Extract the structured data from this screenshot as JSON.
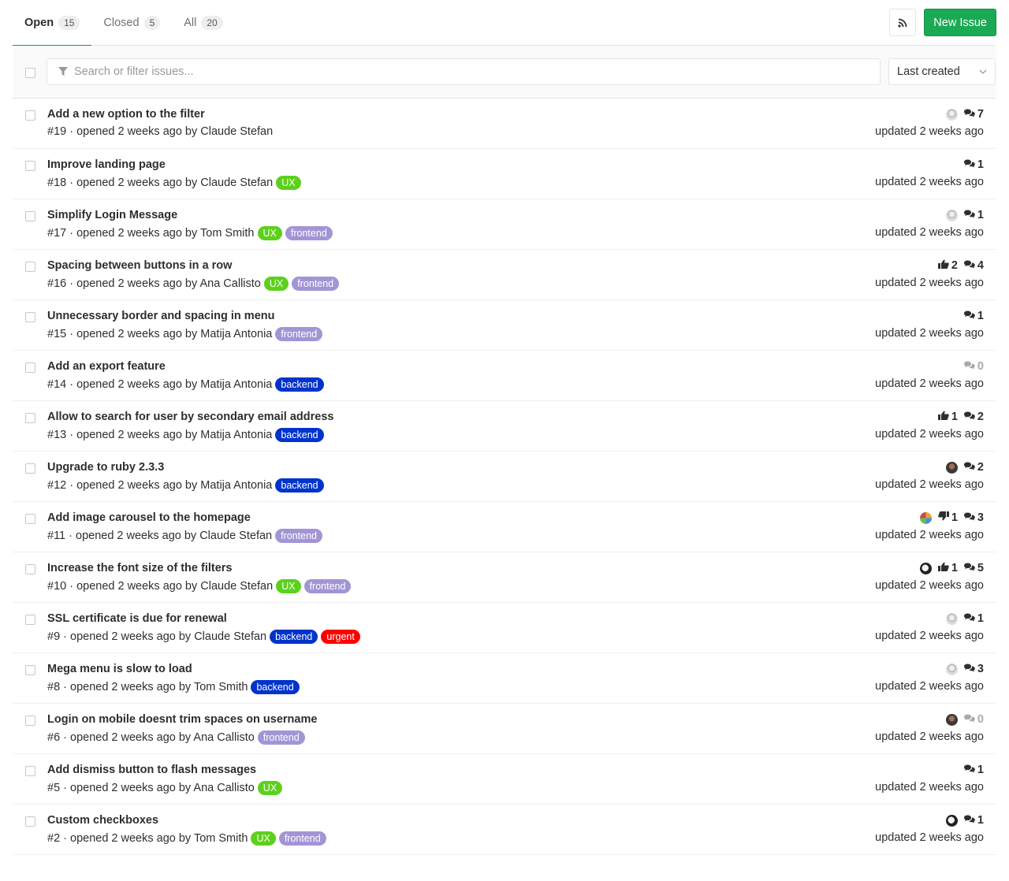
{
  "tabs": [
    {
      "label": "Open",
      "count": "15"
    },
    {
      "label": "Closed",
      "count": "5"
    },
    {
      "label": "All",
      "count": "20"
    }
  ],
  "actions": {
    "new_issue": "New Issue",
    "rss_icon": "rss-icon"
  },
  "filter": {
    "placeholder": "Search or filter issues...",
    "sort": "Last created"
  },
  "colors": {
    "accent": "#1f78d1",
    "new_issue_btn": "#1aaa55",
    "UX": "#5cd11b",
    "frontend": "#a295d6",
    "backend": "#0033cc",
    "urgent": "#ff0000"
  },
  "issues": [
    {
      "title": "Add a new option to the filter",
      "meta": "#19 · opened 2 weeks ago by Claude Stefan",
      "labels": [],
      "avatar": "gray",
      "upvotes": null,
      "downvotes": null,
      "comments": "7",
      "updated": "updated 2 weeks ago"
    },
    {
      "title": "Improve landing page",
      "meta": "#18 · opened 2 weeks ago by Claude Stefan",
      "labels": [
        "UX"
      ],
      "avatar": null,
      "upvotes": null,
      "downvotes": null,
      "comments": "1",
      "updated": "updated 2 weeks ago"
    },
    {
      "title": "Simplify Login Message",
      "meta": "#17 · opened 2 weeks ago by Tom Smith",
      "labels": [
        "UX",
        "frontend"
      ],
      "avatar": "gray",
      "upvotes": null,
      "downvotes": null,
      "comments": "1",
      "updated": "updated 2 weeks ago"
    },
    {
      "title": "Spacing between buttons in a row",
      "meta": "#16 · opened 2 weeks ago by Ana Callisto",
      "labels": [
        "UX",
        "frontend"
      ],
      "avatar": null,
      "upvotes": "2",
      "downvotes": null,
      "comments": "4",
      "updated": "updated 2 weeks ago"
    },
    {
      "title": "Unnecessary border and spacing in menu",
      "meta": "#15 · opened 2 weeks ago by Matija Antonia",
      "labels": [
        "frontend"
      ],
      "avatar": null,
      "upvotes": null,
      "downvotes": null,
      "comments": "1",
      "updated": "updated 2 weeks ago"
    },
    {
      "title": "Add an export feature",
      "meta": "#14 · opened 2 weeks ago by Matija Antonia",
      "labels": [
        "backend"
      ],
      "avatar": null,
      "upvotes": null,
      "downvotes": null,
      "comments": "0",
      "updated": "updated 2 weeks ago"
    },
    {
      "title": "Allow to search for user by secondary email address",
      "meta": "#13 · opened 2 weeks ago by Matija Antonia",
      "labels": [
        "backend"
      ],
      "avatar": null,
      "upvotes": "1",
      "downvotes": null,
      "comments": "2",
      "updated": "updated 2 weeks ago"
    },
    {
      "title": "Upgrade to ruby 2.3.3",
      "meta": "#12 · opened 2 weeks ago by Matija Antonia",
      "labels": [
        "backend"
      ],
      "avatar": "dark",
      "upvotes": null,
      "downvotes": null,
      "comments": "2",
      "updated": "updated 2 weeks ago"
    },
    {
      "title": "Add image carousel to the homepage",
      "meta": "#11 · opened 2 weeks ago by Claude Stefan",
      "labels": [
        "frontend"
      ],
      "avatar": "color",
      "upvotes": null,
      "downvotes": "1",
      "comments": "3",
      "updated": "updated 2 weeks ago"
    },
    {
      "title": "Increase the font size of the filters",
      "meta": "#10 · opened 2 weeks ago by Claude Stefan",
      "labels": [
        "UX",
        "frontend"
      ],
      "avatar": "bw",
      "upvotes": "1",
      "downvotes": null,
      "comments": "5",
      "updated": "updated 2 weeks ago"
    },
    {
      "title": "SSL certificate is due for renewal",
      "meta": "#9 · opened 2 weeks ago by Claude Stefan",
      "labels": [
        "backend",
        "urgent"
      ],
      "avatar": "gray",
      "upvotes": null,
      "downvotes": null,
      "comments": "1",
      "updated": "updated 2 weeks ago"
    },
    {
      "title": "Mega menu is slow to load",
      "meta": "#8 · opened 2 weeks ago by Tom Smith",
      "labels": [
        "backend"
      ],
      "avatar": "gray",
      "upvotes": null,
      "downvotes": null,
      "comments": "3",
      "updated": "updated 2 weeks ago"
    },
    {
      "title": "Login on mobile doesnt trim spaces on username",
      "meta": "#6 · opened 2 weeks ago by Ana Callisto",
      "labels": [
        "frontend"
      ],
      "avatar": "dark",
      "upvotes": null,
      "downvotes": null,
      "comments": "0",
      "updated": "updated 2 weeks ago"
    },
    {
      "title": "Add dismiss button to flash messages",
      "meta": "#5 · opened 2 weeks ago by Ana Callisto",
      "labels": [
        "UX"
      ],
      "avatar": null,
      "upvotes": null,
      "downvotes": null,
      "comments": "1",
      "updated": "updated 2 weeks ago"
    },
    {
      "title": "Custom checkboxes",
      "meta": "#2 · opened 2 weeks ago by Tom Smith",
      "labels": [
        "UX",
        "frontend"
      ],
      "avatar": "bw",
      "upvotes": null,
      "downvotes": null,
      "comments": "1",
      "updated": "updated 2 weeks ago"
    }
  ]
}
